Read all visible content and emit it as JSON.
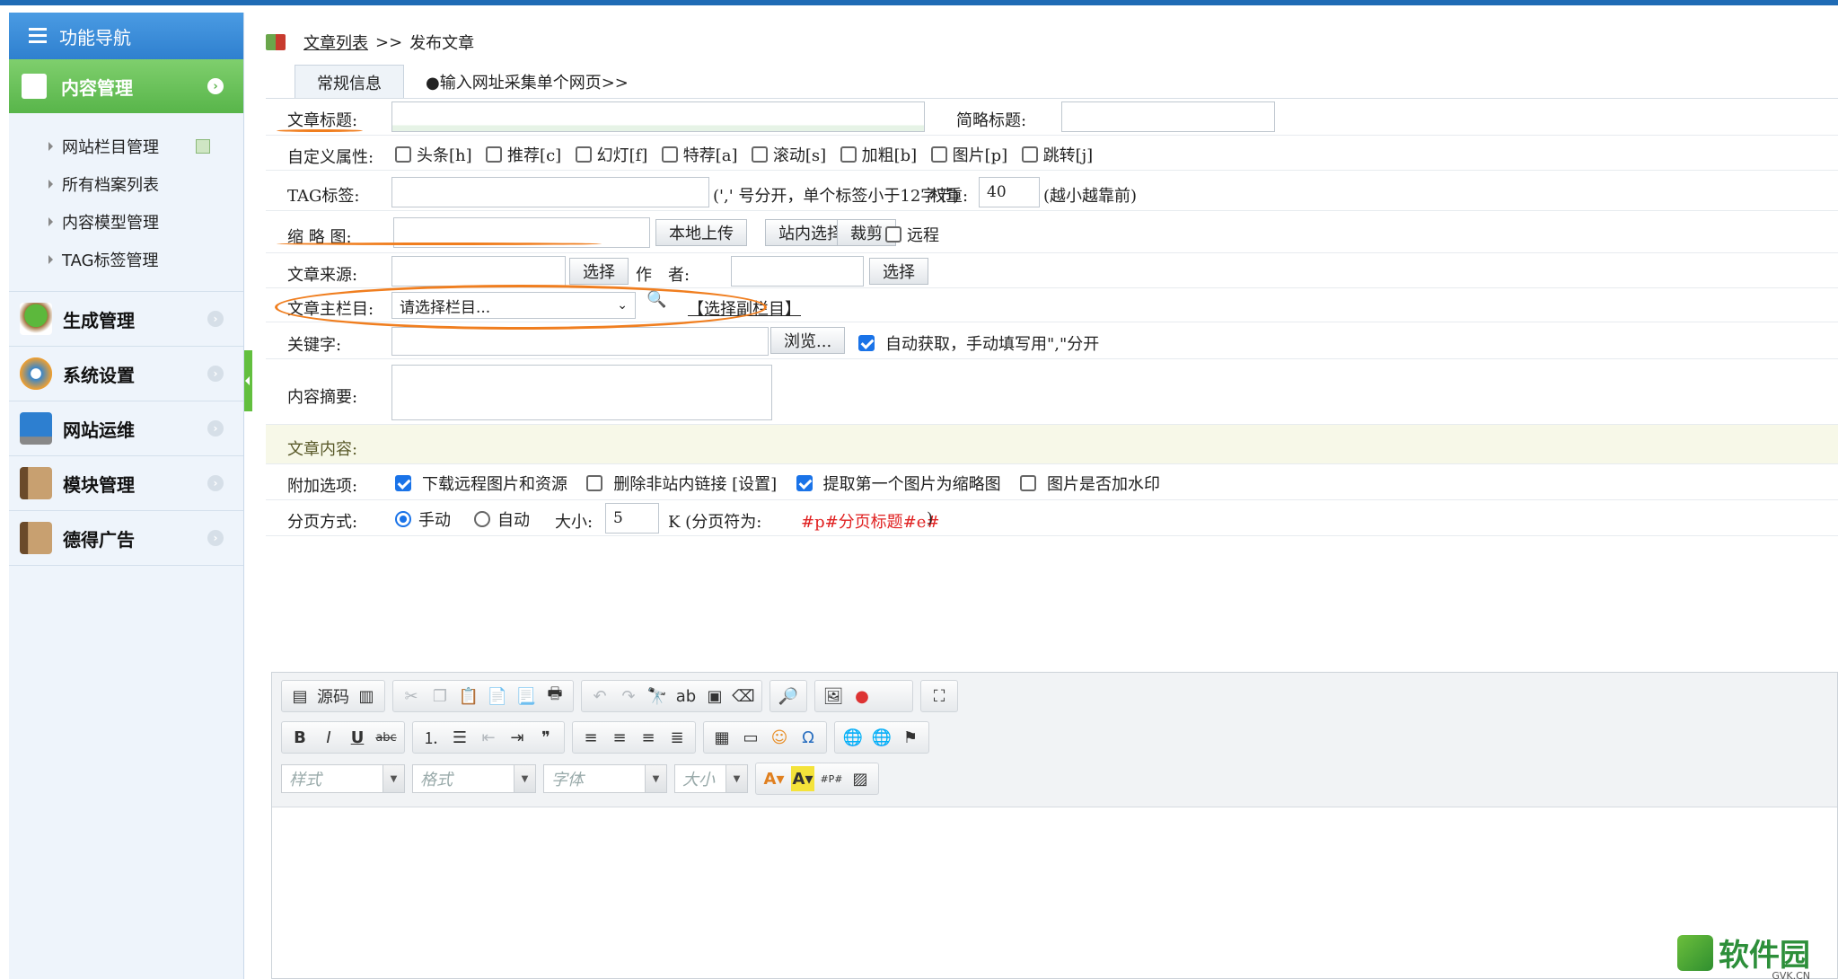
{
  "sidebar": {
    "header": "功能导航",
    "active": "内容管理",
    "sub_items": [
      "网站栏目管理",
      "所有档案列表",
      "内容模型管理",
      "TAG标签管理"
    ],
    "items": [
      "生成管理",
      "系统设置",
      "网站运维",
      "模块管理",
      "德得广告"
    ]
  },
  "breadcrumb": {
    "link": "文章列表",
    "sep": ">>",
    "current": "发布文章"
  },
  "tabs": [
    "常规信息",
    "●输入网址采集单个网页>>"
  ],
  "form": {
    "title_label": "文章标题:",
    "short_title_label": "简略标题:",
    "attr_label": "自定义属性:",
    "attrs": [
      "头条[h]",
      "推荐[c]",
      "幻灯[f]",
      "特荐[a]",
      "滚动[s]",
      "加粗[b]",
      "图片[p]",
      "跳转[j]"
    ],
    "tag_label": "TAG标签:",
    "tag_hint": "(',' 号分开，单个标签小于12字节)",
    "weight_label": "权重:",
    "weight_value": "40",
    "weight_hint": "(越小越靠前)",
    "thumb_label": "缩 略 图:",
    "upload_btn": "本地上传",
    "site_select_btn": "站内选择",
    "crop_btn": "裁剪",
    "remote_label": "远程",
    "source_label": "文章来源:",
    "select_btn": "选择",
    "author_label": "作　者:",
    "author_select_btn": "选择",
    "main_col_label": "文章主栏目:",
    "main_col_value": "请选择栏目...",
    "sub_col_link": "【选择副栏目】",
    "keywords_label": "关键字:",
    "browse_btn": "浏览...",
    "auto_fetch_label": "自动获取，手动填写用\",\"分开",
    "summary_label": "内容摘要:",
    "content_label": "文章内容:",
    "extra_label": "附加选项:",
    "extra_opts": [
      {
        "label": "下载远程图片和资源",
        "checked": true
      },
      {
        "label": "删除非站内链接 [设置]",
        "checked": false
      },
      {
        "label": "提取第一个图片为缩略图",
        "checked": true
      },
      {
        "label": "图片是否加水印",
        "checked": false
      }
    ],
    "paging_label": "分页方式:",
    "paging_manual": "手动",
    "paging_auto": "自动",
    "size_label": "大小:",
    "size_value": "5",
    "size_unit": "K (分页符为:",
    "page_marker": "#p#分页标题#e#",
    "close_paren": ")"
  },
  "editor": {
    "source_btn": "源码",
    "combos": [
      "样式",
      "格式",
      "字体",
      "大小"
    ]
  },
  "watermark": {
    "text": "软件园",
    "sub": "GVK.CN"
  },
  "colors": {
    "orange_annotation": "#f07e1f",
    "nav_green": "#58b54a",
    "nav_blue": "#2f80cf"
  }
}
